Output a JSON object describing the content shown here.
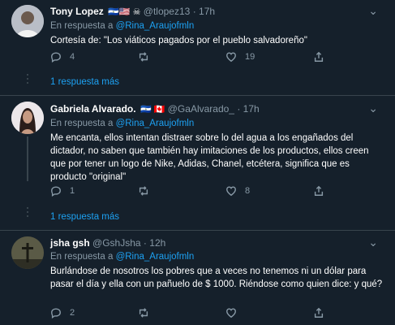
{
  "tweets": [
    {
      "name": "Tony Lopez",
      "flags": "🇸🇻🇺🇸 ☠",
      "handle": "@tlopez13",
      "sep": "·",
      "time": "17h",
      "reply_prefix": "En respuesta a",
      "reply_handle": "@Rina_Araujofmln",
      "text": "Cortesía de: \"Los viáticos pagados por el pueblo salvadoreño\"",
      "replies": "4",
      "retweets": "",
      "likes": "19",
      "more_replies": "1 respuesta más"
    },
    {
      "name": "Gabriela Alvarado.",
      "flags": "🇸🇻 🇨🇦",
      "handle": "@GaAlvarado_",
      "sep": "·",
      "time": "17h",
      "reply_prefix": "En respuesta a",
      "reply_handle": "@Rina_Araujofmln",
      "text": "Me encanta, ellos intentan distraer sobre lo del agua a los engañados del dictador, no saben que también hay imitaciones de los productos, ellos creen que por tener un logo de Nike, Adidas, Chanel, etcétera, significa que es producto \"original\"",
      "replies": "1",
      "retweets": "",
      "likes": "8",
      "more_replies": "1 respuesta más"
    },
    {
      "name": "jsha gsh",
      "flags": "",
      "handle": "@GshJsha",
      "sep": "·",
      "time": "12h",
      "reply_prefix": "En respuesta a",
      "reply_handle": "@Rina_Araujofmln",
      "text": "Burlándose de nosotros los pobres que a veces no tenemos ni un dólar para pasar el día y ella con un pañuelo de $ 1000. Riéndose como quien dice: y qué?",
      "replies": "2",
      "retweets": "",
      "likes": "",
      "more_replies": ""
    }
  ],
  "colors": {
    "background": "#15202b",
    "link": "#1da1f2",
    "muted": "#8899a6",
    "divider": "#38444d"
  },
  "icons": [
    "reply-icon",
    "retweet-icon",
    "like-icon",
    "share-icon",
    "more-icon"
  ]
}
